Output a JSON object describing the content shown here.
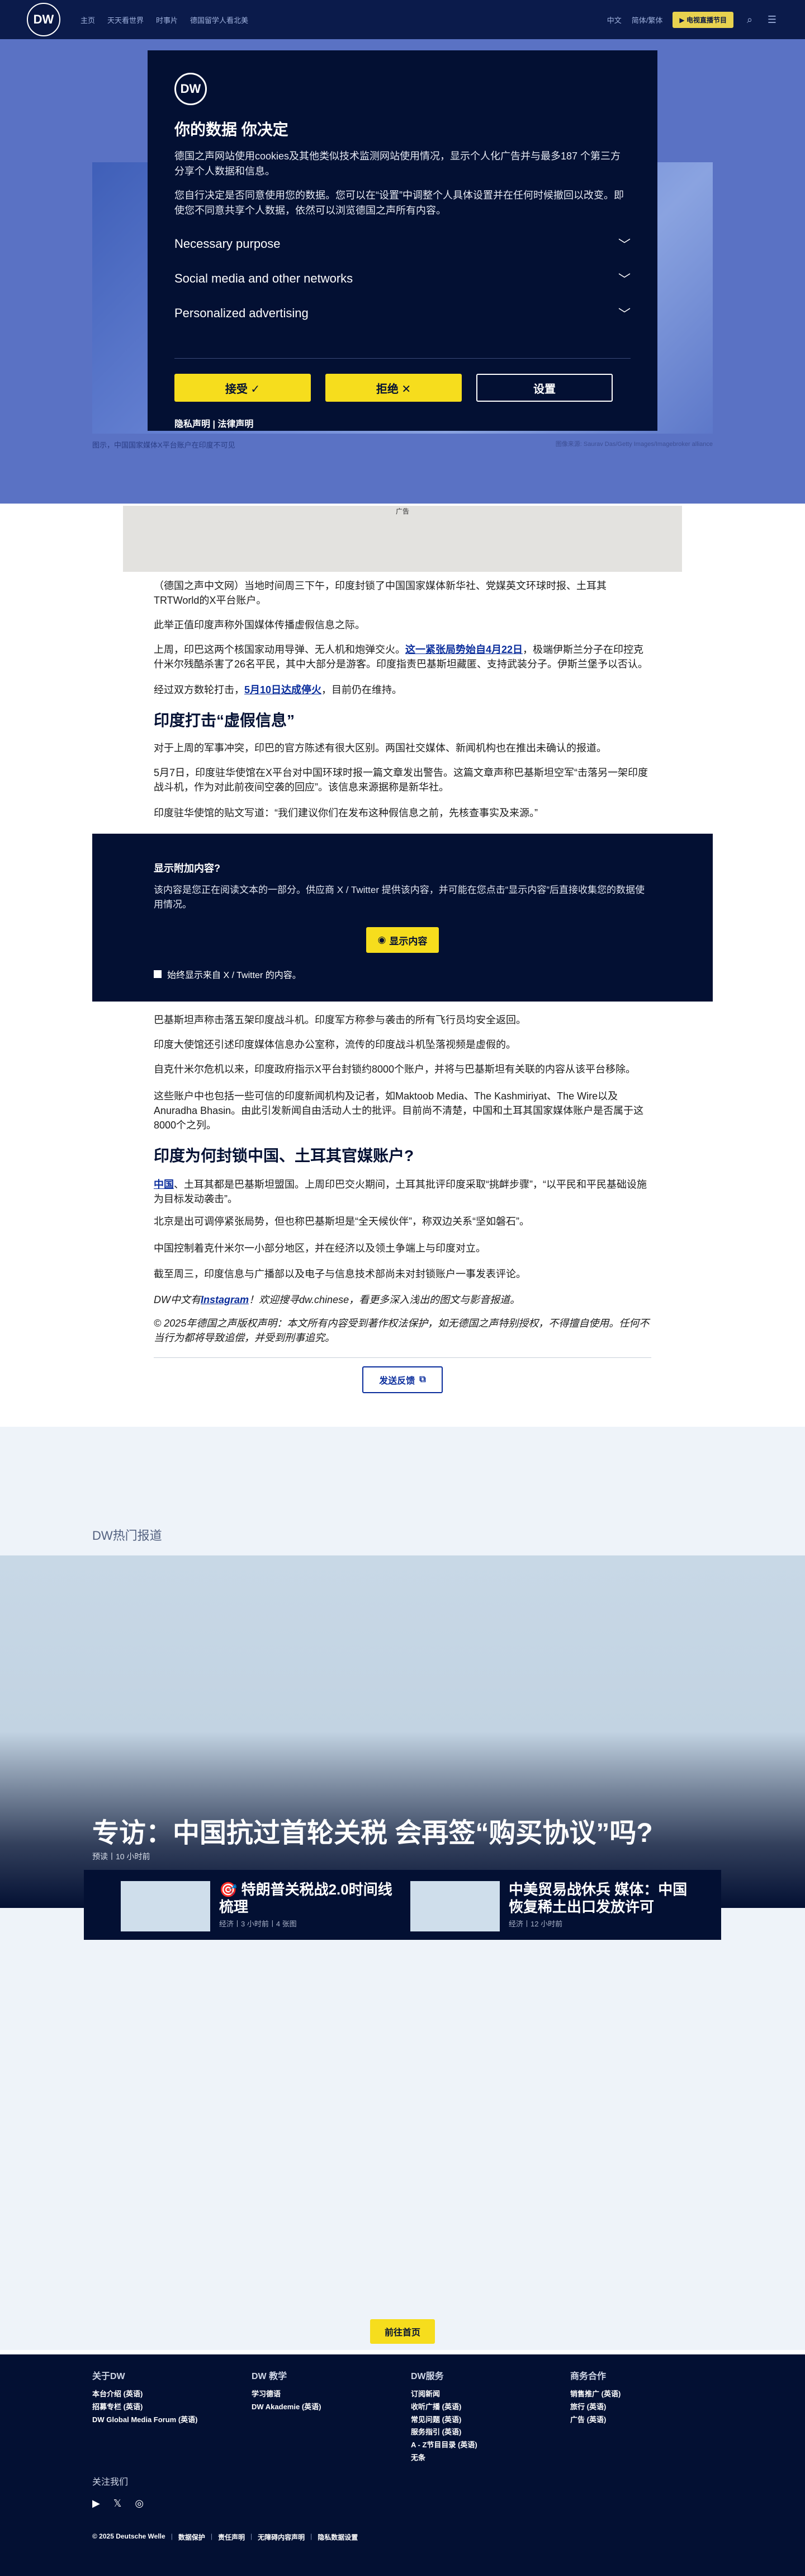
{
  "header": {
    "logo": "DW",
    "nav": [
      "主页",
      "天天看世界",
      "时事片",
      "德国留学人看北美"
    ],
    "lang": "中文",
    "lang2": "简体/繁体",
    "live": "▶ 电视直播节目",
    "icons": [
      "search-icon",
      "menu-icon"
    ]
  },
  "hero": {
    "caption": "图示，中国国家媒体X平台账户在印度不可见",
    "credit": "图像来源: Saurav Das/Getty Images/Imagebroker alliance"
  },
  "consent": {
    "title": "你的数据 你决定",
    "p1": "德国之声网站使用cookies及其他类似技术监测网站使用情况，显示个人化广告并与最多187 个第三方分享个人数据和信息。",
    "p2": "您自行决定是否同意使用您的数据。您可以在“设置”中调整个人具体设置并在任何时候撤回以改变。即使您不同意共享个人数据，依然可以浏览德国之声所有内容。",
    "rows": [
      "Necessary purpose",
      "Social media and other networks",
      "Personalized advertising"
    ],
    "accept": "接受 ✓",
    "reject": "拒绝 ✕",
    "settings": "设置",
    "privacy": "隐私声明",
    "legal": "法律声明"
  },
  "ad": {
    "label": "广告"
  },
  "article": {
    "p1": "（德国之声中文网）当地时间周三下午，印度封锁了中国国家媒体新华社、党媒英文环球时报、土耳其TRTWorld的X平台账户。",
    "p2": "此举正值印度声称外国媒体传播虚假信息之际。",
    "p3a": "上周，印巴这两个核国家动用导弹、无人机和炮弹交火。",
    "p3link": "这一紧张局势始自4月22日",
    "p3b": "，极端伊斯兰分子在印控克什米尔残酷杀害了26名平民，其中大部分是游客。印度指责巴基斯坦藏匿、支持武装分子。伊斯兰堡予以否认。",
    "p4a": "经过双方数轮打击，",
    "p4link": "5月10日达成停火",
    "p4b": "，目前仍在维持。",
    "h1": "印度打击“虚假信息”",
    "p5": "对于上周的军事冲突，印巴的官方陈述有很大区别。两国社交媒体、新闻机构也在推出未确认的报道。",
    "p6": "5月7日，印度驻华使馆在X平台对中国环球时报一篇文章发出警告。这篇文章声称巴基斯坦空军“击落另一架印度战斗机，作为对此前夜间空袭的回应”。该信息来源据称是新华社。",
    "p7": "印度驻华使馆的贴文写道：“我们建议你们在发布这种假信息之前，先核查事实及来源。”",
    "p8": "巴基斯坦声称击落五架印度战斗机。印度军方称参与袭击的所有飞行员均安全返回。",
    "p9": "印度大使馆还引述印度媒体信息办公室称，流传的印度战斗机坠落视频是虚假的。",
    "p10": "自克什米尔危机以来，印度政府指示X平台封锁约8000个账户，并将与巴基斯坦有关联的内容从该平台移除。",
    "p11": "这些账户中也包括一些可信的印度新闻机构及记者，如Maktoob Media、The Kashmiriyat、The Wire以及Anuradha Bhasin。由此引发新闻自由活动人士的批评。目前尚不清楚，中国和土耳其国家媒体账户是否属于这8000个之列。",
    "h2": "印度为何封锁中国、土耳其官媒账户?",
    "p12link": "中国",
    "p12": "、土耳其都是巴基斯坦盟国。上周印巴交火期间，土耳其批评印度采取“挑衅步骤”，“以平民和平民基础设施为目标发动袭击”。",
    "p13": "北京是出可调停紧张局势，但也称巴基斯坦是“全天候伙伴”，称双边关系“坚如磐石”。",
    "p14": "中国控制着克什米尔一小部分地区，并在经济以及领土争端上与印度对立。",
    "p15": "截至周三，印度信息与广播部以及电子与信息技术部尚未对封锁账户一事发表评论。",
    "p16a": "DW中文有",
    "p16link": "Instagram",
    "p16b": "！欢迎搜寻dw.chinese，看更多深入浅出的图文与影音报道。",
    "p17": "© 2025年德国之声版权声明：本文所有内容受到著作权法保护，如无德国之声特别授权，不得擅自使用。任何不当行为都将导致追偿，并受到刑事追究。"
  },
  "xembed": {
    "title": "显示附加内容?",
    "desc": "该内容是您正在阅读文本的一部分。供应商 X / Twitter 提供该内容，并可能在您点击“显示内容”后直接收集您的数据使用情况。",
    "show": "显示内容",
    "always": "始终显示来自 X / Twitter 的内容。"
  },
  "feedback": "发送反馈",
  "popular": {
    "title": "DW热门报道",
    "hero_title": "专访：中国抗过首轮关税 会再签“购买协议”吗?",
    "hero_meta": "预读丨10 小时前",
    "cards": [
      {
        "title": "🎯 特朗普关税战2.0时间线梳理",
        "meta": "经济丨3 小时前丨4 张图"
      },
      {
        "title": "中美贸易战休兵 媒体：中国恢复稀土出口发放许可",
        "meta": "经济丨12 小时前"
      }
    ]
  },
  "goto": "前往首页",
  "footer": {
    "cols": [
      {
        "h": "关于DW",
        "items": [
          "本台介绍 (英语)",
          "招募专栏 (英语)",
          "DW Global Media Forum (英语)"
        ]
      },
      {
        "h": "DW 教学",
        "items": [
          "学习德语",
          "DW Akademie (英语)"
        ]
      },
      {
        "h": "DW服务",
        "items": [
          "订阅新闻",
          "收听广播 (英语)",
          "常见问题 (英语)",
          "服务指引 (英语)",
          "A - Z节目目录 (英语)",
          "无条"
        ]
      },
      {
        "h": "商务合作",
        "items": [
          "销售推广 (英语)",
          "旅行 (英语)",
          "广告 (英语)"
        ]
      }
    ],
    "follow": "关注我们",
    "social": [
      "youtube-icon",
      "x-icon",
      "instagram-icon"
    ],
    "legal": [
      "© 2025 Deutsche Welle",
      "数据保护",
      "责任声明",
      "无障碍内容声明",
      "隐私数据设置"
    ]
  }
}
